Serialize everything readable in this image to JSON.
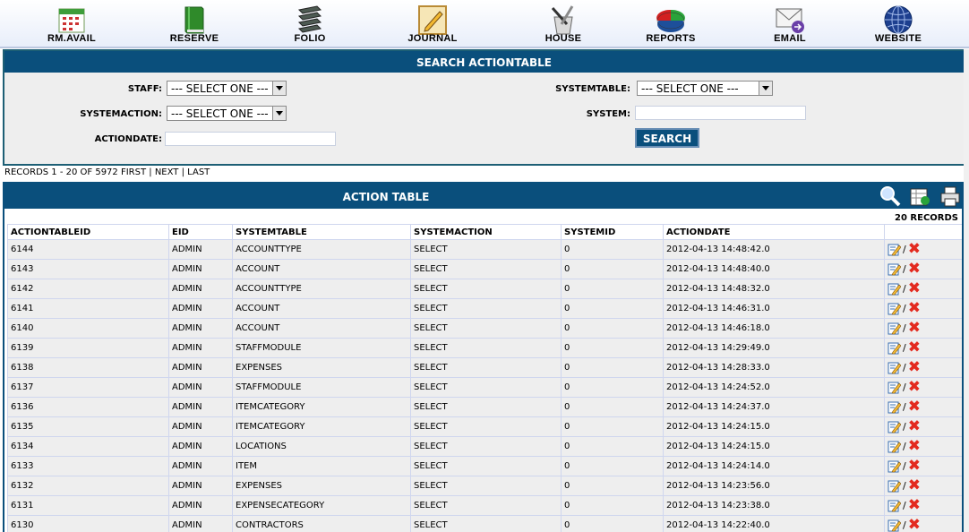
{
  "nav": [
    {
      "label": "RM.AVAIL",
      "icon": "calendar-icon"
    },
    {
      "label": "RESERVE",
      "icon": "book-icon"
    },
    {
      "label": "FOLIO",
      "icon": "folio-stack-icon"
    },
    {
      "label": "JOURNAL",
      "icon": "journal-pencil-icon"
    },
    {
      "label": "HOUSE",
      "icon": "housekeeping-bucket-icon"
    },
    {
      "label": "REPORTS",
      "icon": "pie-chart-icon"
    },
    {
      "label": "EMAIL",
      "icon": "email-envelope-icon"
    },
    {
      "label": "WEBSITE",
      "icon": "globe-icon"
    }
  ],
  "search": {
    "title": "SEARCH ACTIONTABLE",
    "staff_label": "STAFF:",
    "staff_value": "--- SELECT ONE ---",
    "systemaction_label": "SYSTEMACTION:",
    "systemaction_value": "--- SELECT ONE ---",
    "actiondate_label": "ACTIONDATE:",
    "actiondate_value": "",
    "systemtable_label": "SYSTEMTABLE:",
    "systemtable_value": "--- SELECT ONE ---",
    "system_label": "SYSTEM:",
    "system_value": "",
    "button_label": "SEARCH"
  },
  "pager": {
    "records_text": "RECORDS 1 - 20 OF 5972",
    "first": "FIRST",
    "next": "NEXT",
    "last": "LAST",
    "sep": "|"
  },
  "results": {
    "title": "ACTION TABLE",
    "record_count": "20 RECORDS",
    "icons": [
      "search-magnifier-icon",
      "export-excel-icon",
      "print-icon"
    ],
    "columns": [
      "ACTIONTABLEID",
      "EID",
      "SYSTEMTABLE",
      "SYSTEMACTION",
      "SYSTEMID",
      "ACTIONDATE",
      ""
    ],
    "action_sep": "/",
    "delete_glyph": "✖",
    "rows": [
      [
        "6144",
        "ADMIN",
        "ACCOUNTTYPE",
        "SELECT",
        "0",
        "2012-04-13 14:48:42.0"
      ],
      [
        "6143",
        "ADMIN",
        "ACCOUNT",
        "SELECT",
        "0",
        "2012-04-13 14:48:40.0"
      ],
      [
        "6142",
        "ADMIN",
        "ACCOUNTTYPE",
        "SELECT",
        "0",
        "2012-04-13 14:48:32.0"
      ],
      [
        "6141",
        "ADMIN",
        "ACCOUNT",
        "SELECT",
        "0",
        "2012-04-13 14:46:31.0"
      ],
      [
        "6140",
        "ADMIN",
        "ACCOUNT",
        "SELECT",
        "0",
        "2012-04-13 14:46:18.0"
      ],
      [
        "6139",
        "ADMIN",
        "STAFFMODULE",
        "SELECT",
        "0",
        "2012-04-13 14:29:49.0"
      ],
      [
        "6138",
        "ADMIN",
        "EXPENSES",
        "SELECT",
        "0",
        "2012-04-13 14:28:33.0"
      ],
      [
        "6137",
        "ADMIN",
        "STAFFMODULE",
        "SELECT",
        "0",
        "2012-04-13 14:24:52.0"
      ],
      [
        "6136",
        "ADMIN",
        "ITEMCATEGORY",
        "SELECT",
        "0",
        "2012-04-13 14:24:37.0"
      ],
      [
        "6135",
        "ADMIN",
        "ITEMCATEGORY",
        "SELECT",
        "0",
        "2012-04-13 14:24:15.0"
      ],
      [
        "6134",
        "ADMIN",
        "LOCATIONS",
        "SELECT",
        "0",
        "2012-04-13 14:24:15.0"
      ],
      [
        "6133",
        "ADMIN",
        "ITEM",
        "SELECT",
        "0",
        "2012-04-13 14:24:14.0"
      ],
      [
        "6132",
        "ADMIN",
        "EXPENSES",
        "SELECT",
        "0",
        "2012-04-13 14:23:56.0"
      ],
      [
        "6131",
        "ADMIN",
        "EXPENSECATEGORY",
        "SELECT",
        "0",
        "2012-04-13 14:23:38.0"
      ],
      [
        "6130",
        "ADMIN",
        "CONTRACTORS",
        "SELECT",
        "0",
        "2012-04-13 14:22:40.0"
      ]
    ]
  },
  "colors": {
    "header_blue": "#0a4f7c",
    "row_bg": "#eeeeee",
    "delete_red": "#e32a1f"
  }
}
